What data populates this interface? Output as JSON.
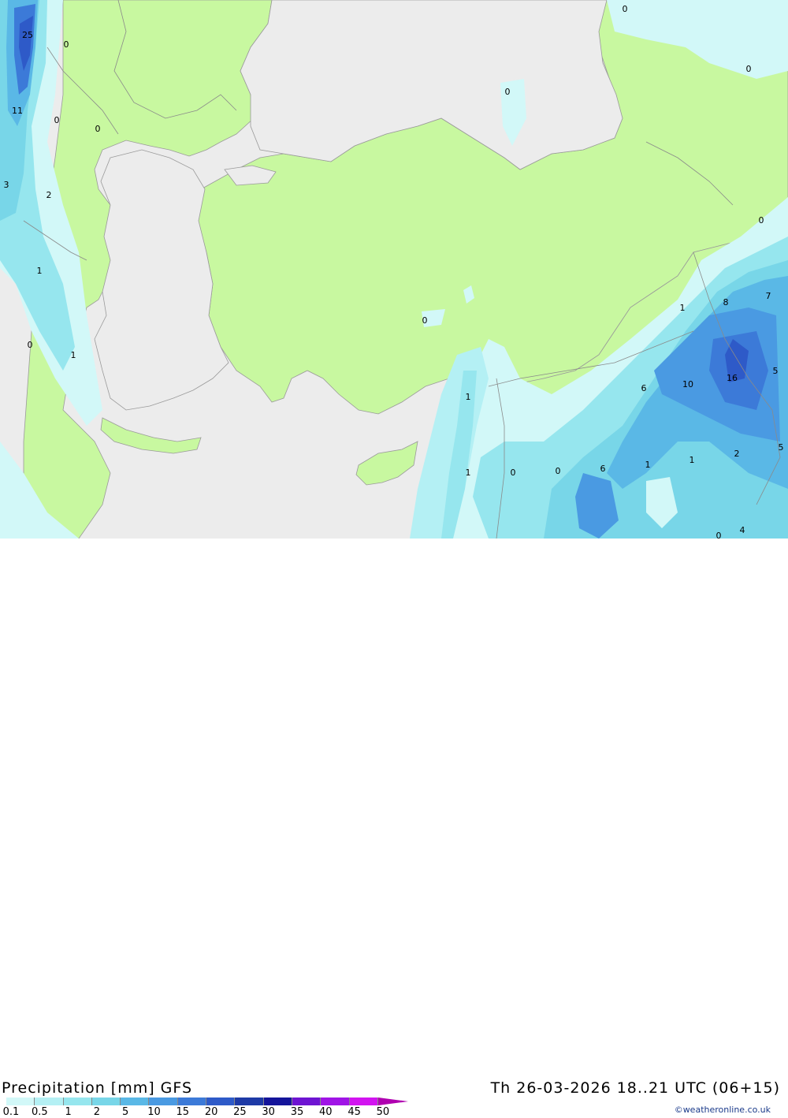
{
  "header": {
    "title": "Precipitation [mm] GFS",
    "valid_time": "Th 26-03-2026 18..21 UTC (06+15)",
    "credit": "©weatheronline.co.uk"
  },
  "legend": {
    "labels": [
      "0.1",
      "0.5",
      "1",
      "2",
      "5",
      "10",
      "15",
      "20",
      "25",
      "30",
      "35",
      "40",
      "45",
      "50"
    ],
    "colors": [
      "#d2f8f8",
      "#b4f0f4",
      "#96e6ee",
      "#78d6e8",
      "#5ab8e6",
      "#4a9ae2",
      "#3c7ad8",
      "#2e5ac8",
      "#1e3aa6",
      "#14149a",
      "#6e14d2",
      "#a014e6",
      "#d214f0",
      "#b000b0"
    ]
  },
  "map": {
    "colors": {
      "sea": "#ececec",
      "land": "#c8f8a0",
      "border": "#999999"
    },
    "values": [
      "25",
      "0",
      "11",
      "0",
      "0",
      "3",
      "2",
      "1",
      "0",
      "1",
      "0",
      "0",
      "0",
      "0",
      "0",
      "8",
      "7",
      "1",
      "16",
      "5",
      "6",
      "10",
      "1",
      "1",
      "0",
      "0",
      "6",
      "1",
      "1",
      "2",
      "5",
      "0",
      "4"
    ]
  }
}
